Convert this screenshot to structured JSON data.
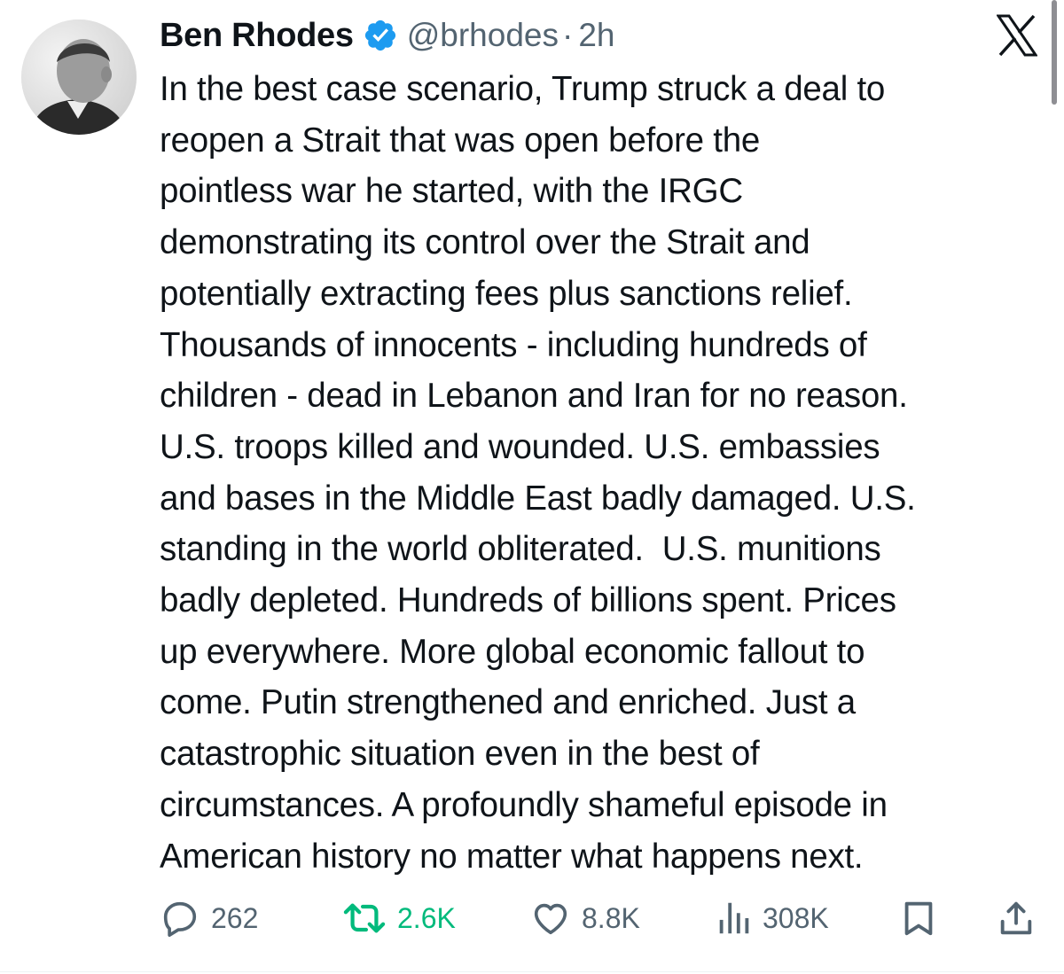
{
  "tweet": {
    "author": {
      "display_name": "Ben Rhodes",
      "handle": "@brhodes",
      "verified": true,
      "avatar_icon": "profile-photo"
    },
    "separator": "·",
    "time": "2h",
    "lines": [
      "In the best case scenario, Trump struck a deal to",
      "reopen a Strait that was open before the",
      "pointless war he started, with the IRGC",
      "demonstrating its control over the Strait and",
      "potentially extracting fees plus sanctions relief.",
      "Thousands of innocents - including hundreds of",
      "children - dead in Lebanon and Iran for no reason.",
      "U.S. troops killed and wounded. U.S. embassies",
      "and bases in the Middle East badly damaged. U.S.",
      "standing in the world obliterated.  U.S. munitions",
      "badly depleted. Hundreds of billions spent. Prices",
      "up everywhere. More global economic fallout to",
      "come. Putin strengthened and enriched. Just a",
      "catastrophic situation even in the best of",
      "circumstances. A profoundly shameful episode in",
      "American history no matter what happens next."
    ],
    "stats": {
      "replies": "262",
      "reposts": "2.6K",
      "likes": "8.8K",
      "views": "308K"
    }
  },
  "icons": {
    "brand": "x-logo-icon",
    "reply": "reply-icon",
    "repost": "repost-icon",
    "like": "heart-icon",
    "views": "views-icon",
    "bookmark": "bookmark-icon",
    "share": "share-icon",
    "verified": "verified-badge-icon"
  },
  "colors": {
    "text": "#0f1419",
    "secondary": "#536471",
    "verified": "#1d9bf0",
    "repost_active": "#00ba7c",
    "background": "#ffffff"
  }
}
